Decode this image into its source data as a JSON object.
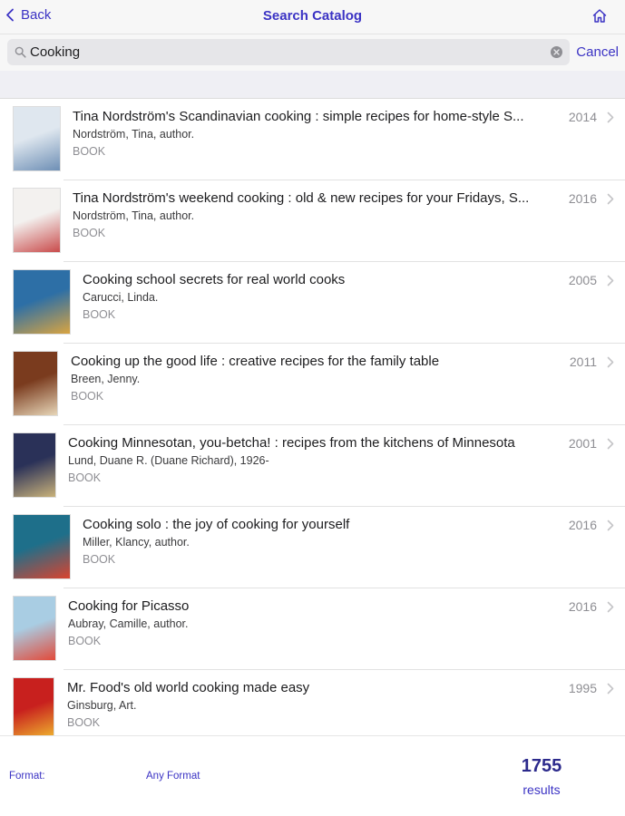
{
  "nav": {
    "back_label": "Back",
    "title": "Search Catalog",
    "home_icon": "home-icon"
  },
  "search": {
    "value": "Cooking",
    "cancel_label": "Cancel"
  },
  "results": [
    {
      "title": "Tina Nordström's Scandinavian cooking : simple recipes for home-style S...",
      "author": "Nordström, Tina, author.",
      "format": "BOOK",
      "year": "2014",
      "cover_colors": [
        "#dfe7ef",
        "#6e8fb5"
      ]
    },
    {
      "title": "Tina Nordström's weekend cooking : old & new recipes for your Fridays, S...",
      "author": "Nordström, Tina, author.",
      "format": "BOOK",
      "year": "2016",
      "cover_colors": [
        "#f3f1ef",
        "#c94b4b"
      ]
    },
    {
      "title": "Cooking school secrets for real world cooks",
      "author": "Carucci, Linda.",
      "format": "BOOK",
      "year": "2005",
      "cover_colors": [
        "#2d6fa6",
        "#d9a441"
      ]
    },
    {
      "title": "Cooking up the good life : creative recipes for the family table",
      "author": "Breen, Jenny.",
      "format": "BOOK",
      "year": "2011",
      "cover_colors": [
        "#7a3b1e",
        "#e7d6b8"
      ]
    },
    {
      "title": "Cooking Minnesotan, you-betcha! : recipes from the kitchens of Minnesota",
      "author": "Lund, Duane R. (Duane Richard), 1926-",
      "format": "BOOK",
      "year": "2001",
      "cover_colors": [
        "#2a3158",
        "#c9b27a"
      ]
    },
    {
      "title": "Cooking solo : the joy of cooking for yourself",
      "author": "Miller, Klancy, author.",
      "format": "BOOK",
      "year": "2016",
      "cover_colors": [
        "#1e6f8a",
        "#d9432f"
      ]
    },
    {
      "title": "Cooking for Picasso",
      "author": "Aubray, Camille, author.",
      "format": "BOOK",
      "year": "2016",
      "cover_colors": [
        "#a9cde3",
        "#e24a3a"
      ]
    },
    {
      "title": "Mr. Food's old world cooking made easy",
      "author": "Ginsburg, Art.",
      "format": "BOOK",
      "year": "1995",
      "cover_colors": [
        "#c8201e",
        "#f2c230"
      ]
    }
  ],
  "footer": {
    "format_label": "Format:",
    "format_value": "Any Format",
    "count": "1755",
    "count_label": "results"
  },
  "colors": {
    "accent": "#3b33c4",
    "count": "#2c2a8c"
  }
}
